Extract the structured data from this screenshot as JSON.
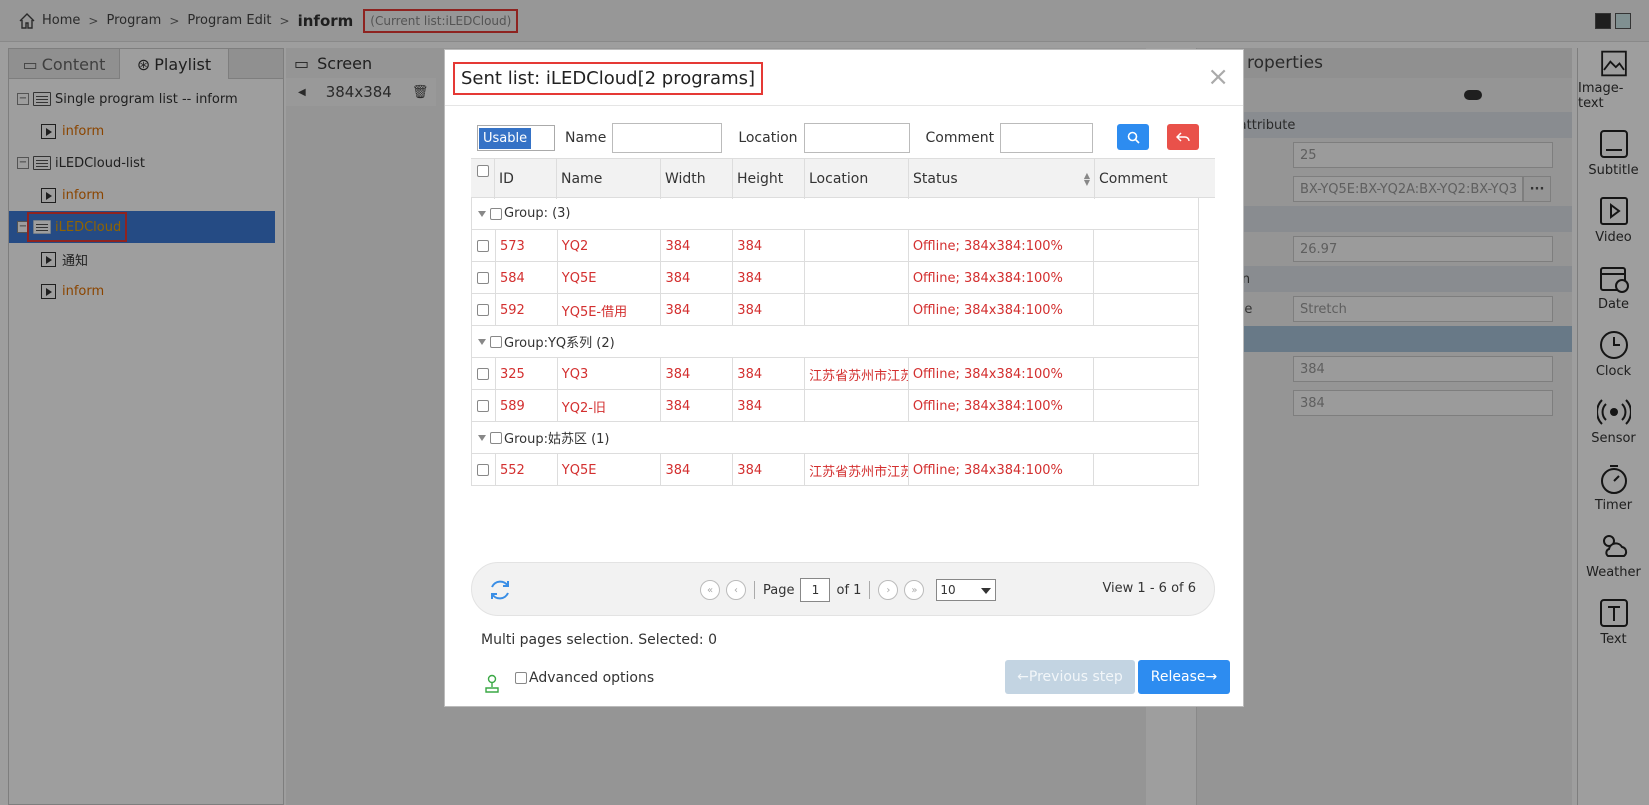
{
  "breadcrumb": {
    "home": "Home",
    "program": "Program",
    "program_edit": "Program Edit",
    "current": "inform",
    "current_list": "(Current list:iLEDCloud)"
  },
  "left_panel": {
    "tabs": [
      "Content",
      "Playlist"
    ],
    "tree": [
      {
        "label": "Single program list -- inform",
        "children": [
          "inform"
        ]
      },
      {
        "label": "iLEDCloud-list",
        "children": [
          "inform"
        ]
      },
      {
        "label": "iLEDCloud",
        "children": [
          "通知",
          "inform"
        ]
      }
    ]
  },
  "center_panel": {
    "tab": "Screen",
    "size": "384x384"
  },
  "right_panel": {
    "header": "roperties",
    "toggle_label": "m",
    "sections": [
      "sic attribute",
      "me",
      "ption",
      "e"
    ],
    "rows": [
      {
        "label": "nce",
        "value": "25"
      },
      {
        "label": "e",
        "value": "BX-YQ5E:BX-YQ2A:BX-YQ2:BX-YQ3"
      },
      {
        "label": "me",
        "value": "26.97"
      },
      {
        "label": "Mode",
        "value": "Stretch"
      },
      {
        "label": "",
        "value": "384"
      },
      {
        "label": "t",
        "value": "384"
      }
    ]
  },
  "toolbar": [
    "Image-text",
    "Subtitle",
    "Video",
    "Date",
    "Clock",
    "Sensor",
    "Timer",
    "Weather",
    "Text"
  ],
  "modal": {
    "title": "Sent list: iLEDCloud[2 programs]",
    "close": "×",
    "filter": {
      "usable": "Usable",
      "name_label": "Name",
      "location_label": "Location",
      "comment_label": "Comment"
    },
    "columns": [
      "ID",
      "Name",
      "Width",
      "Height",
      "Location",
      "Status",
      "Comment"
    ],
    "groups": [
      {
        "label": "Group: (3)",
        "rows": [
          {
            "id": "573",
            "name": "YQ2",
            "width": "384",
            "height": "384",
            "location": "",
            "status": "Offline; 384x384:100%",
            "comment": ""
          },
          {
            "id": "584",
            "name": "YQ5E",
            "width": "384",
            "height": "384",
            "location": "",
            "status": "Offline; 384x384:100%",
            "comment": ""
          },
          {
            "id": "592",
            "name": "YQ5E-借用",
            "width": "384",
            "height": "384",
            "location": "",
            "status": "Offline; 384x384:100%",
            "comment": ""
          }
        ]
      },
      {
        "label": "Group:YQ系列 (2)",
        "rows": [
          {
            "id": "325",
            "name": "YQ3",
            "width": "384",
            "height": "384",
            "location": "江苏省苏州市江苏",
            "status": "Offline; 384x384:100%",
            "comment": ""
          },
          {
            "id": "589",
            "name": "YQ2-旧",
            "width": "384",
            "height": "384",
            "location": "",
            "status": "Offline; 384x384:100%",
            "comment": ""
          }
        ]
      },
      {
        "label": "Group:姑苏区 (1)",
        "rows": [
          {
            "id": "552",
            "name": "YQ5E",
            "width": "384",
            "height": "384",
            "location": "江苏省苏州市江苏",
            "status": "Offline; 384x384:100%",
            "comment": ""
          }
        ]
      }
    ],
    "pager": {
      "page_label": "Page",
      "page": "1",
      "of": "of 1",
      "page_size": "10",
      "view": "View 1 - 6 of 6"
    },
    "multi_selection": "Multi pages selection. Selected: 0",
    "advanced": "Advanced options",
    "prev": "←Previous step",
    "release": "Release→"
  },
  "colors": {
    "accent": "#2d8cf0",
    "danger": "#e9514a",
    "highlight": "#e53935",
    "offline": "#d32f2f"
  }
}
